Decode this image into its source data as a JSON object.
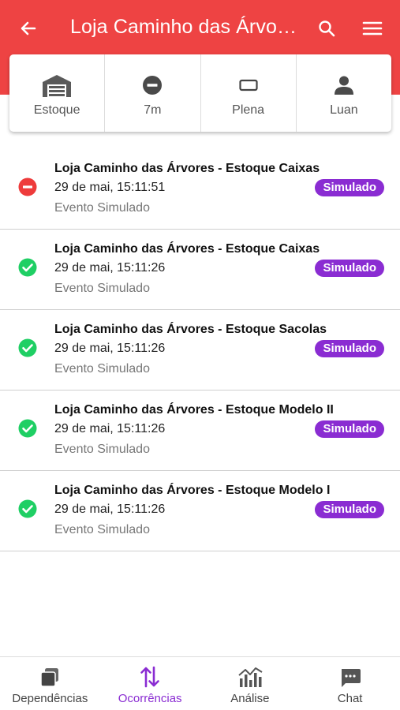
{
  "header": {
    "title": "Loja Caminho das Árvores"
  },
  "status": [
    {
      "label": "Estoque",
      "icon": "warehouse-icon"
    },
    {
      "label": "7m",
      "icon": "minus-circle-icon"
    },
    {
      "label": "Plena",
      "icon": "rectangle-outline-icon"
    },
    {
      "label": "Luan",
      "icon": "user-icon"
    }
  ],
  "events": [
    {
      "title": "Loja Caminho das Árvores - Estoque Caixas",
      "time": "29 de mai, 15:11:51",
      "subtitle": "Evento Simulado",
      "badge": "Simulado",
      "status": "alarm",
      "icon": "minus-circle-icon"
    },
    {
      "title": "Loja Caminho das Árvores - Estoque Caixas",
      "time": "29 de mai, 15:11:26",
      "subtitle": "Evento Simulado",
      "badge": "Simulado",
      "status": "ok",
      "icon": "check-circle-icon"
    },
    {
      "title": "Loja Caminho das Árvores - Estoque Sacolas",
      "time": "29 de mai, 15:11:26",
      "subtitle": "Evento Simulado",
      "badge": "Simulado",
      "status": "ok",
      "icon": "check-circle-icon"
    },
    {
      "title": "Loja Caminho das Árvores - Estoque Modelo II",
      "time": "29 de mai, 15:11:26",
      "subtitle": "Evento Simulado",
      "badge": "Simulado",
      "status": "ok",
      "icon": "check-circle-icon"
    },
    {
      "title": "Loja Caminho das Árvores - Estoque Modelo I",
      "time": "29 de mai, 15:11:26",
      "subtitle": "Evento Simulado",
      "badge": "Simulado",
      "status": "ok",
      "icon": "check-circle-icon"
    }
  ],
  "nav": [
    {
      "label": "Dependências",
      "icon": "stacked-squares-icon",
      "active": false
    },
    {
      "label": "Ocorrências",
      "icon": "sort-arrows-icon",
      "active": true
    },
    {
      "label": "Análise",
      "icon": "chart-icon",
      "active": false
    },
    {
      "label": "Chat",
      "icon": "chat-icon",
      "active": false
    }
  ],
  "colors": {
    "header": "#ee4343",
    "accent": "#8a2cd2",
    "ok": "#1fcf64",
    "alarm": "#ee3b3b"
  }
}
